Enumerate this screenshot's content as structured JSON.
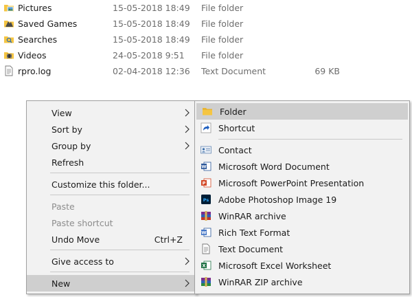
{
  "files": [
    {
      "name": "Pictures",
      "date": "15-05-2018 18:49",
      "type": "File folder",
      "size": "",
      "icon": "pictures-folder-icon"
    },
    {
      "name": "Saved Games",
      "date": "15-05-2018 18:49",
      "type": "File folder",
      "size": "",
      "icon": "saved-games-folder-icon"
    },
    {
      "name": "Searches",
      "date": "15-05-2018 18:49",
      "type": "File folder",
      "size": "",
      "icon": "searches-folder-icon"
    },
    {
      "name": "Videos",
      "date": "24-05-2018 9:51",
      "type": "File folder",
      "size": "",
      "icon": "videos-folder-icon"
    },
    {
      "name": "rpro.log",
      "date": "02-04-2018 12:36",
      "type": "Text Document",
      "size": "69 KB",
      "icon": "text-file-icon"
    }
  ],
  "context_menu": {
    "view": "View",
    "sort_by": "Sort by",
    "group_by": "Group by",
    "refresh": "Refresh",
    "customize": "Customize this folder...",
    "paste": "Paste",
    "paste_shortcut": "Paste shortcut",
    "undo_move": "Undo Move",
    "undo_move_shortcut": "Ctrl+Z",
    "give_access": "Give access to",
    "new": "New"
  },
  "new_submenu": {
    "folder": "Folder",
    "shortcut": "Shortcut",
    "contact": "Contact",
    "word": "Microsoft Word Document",
    "powerpoint": "Microsoft PowerPoint Presentation",
    "photoshop": "Adobe Photoshop Image 19",
    "winrar": "WinRAR archive",
    "rtf": "Rich Text Format",
    "text": "Text Document",
    "excel": "Microsoft Excel Worksheet",
    "winrar_zip": "WinRAR ZIP archive"
  },
  "colors": {
    "menu_bg": "#f2f2f2",
    "hover_bg": "#cfcfcf",
    "disabled_text": "#8c8c8c",
    "folder_yellow": "#f5c542",
    "word_blue": "#2b579a",
    "ppt_orange": "#d24726",
    "excel_green": "#217346",
    "ps_blue": "#31a8ff"
  }
}
